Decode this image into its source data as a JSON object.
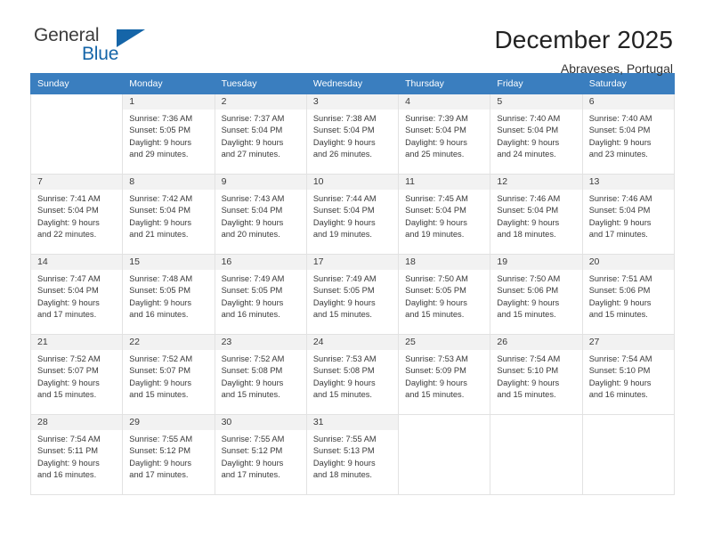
{
  "brand": {
    "word_one": "General",
    "word_two": "Blue",
    "accent_color": "#1565a8",
    "triangle_icon": "brand-triangle-icon"
  },
  "header": {
    "title": "December 2025",
    "subtitle": "Abraveses, Portugal"
  },
  "calendar": {
    "header_bg": "#3a7ebf",
    "daynum_band_bg": "#f2f2f2",
    "grid_line_color": "#e2e2e2",
    "weekday_headers": [
      "Sunday",
      "Monday",
      "Tuesday",
      "Wednesday",
      "Thursday",
      "Friday",
      "Saturday"
    ],
    "labels": {
      "sunrise_prefix": "Sunrise:",
      "sunset_prefix": "Sunset:",
      "daylight_prefix": "Daylight:"
    },
    "weeks": [
      [
        {
          "day": "",
          "lines": []
        },
        {
          "day": "1",
          "lines": [
            "Sunrise: 7:36 AM",
            "Sunset: 5:05 PM",
            "Daylight: 9 hours",
            "and 29 minutes."
          ]
        },
        {
          "day": "2",
          "lines": [
            "Sunrise: 7:37 AM",
            "Sunset: 5:04 PM",
            "Daylight: 9 hours",
            "and 27 minutes."
          ]
        },
        {
          "day": "3",
          "lines": [
            "Sunrise: 7:38 AM",
            "Sunset: 5:04 PM",
            "Daylight: 9 hours",
            "and 26 minutes."
          ]
        },
        {
          "day": "4",
          "lines": [
            "Sunrise: 7:39 AM",
            "Sunset: 5:04 PM",
            "Daylight: 9 hours",
            "and 25 minutes."
          ]
        },
        {
          "day": "5",
          "lines": [
            "Sunrise: 7:40 AM",
            "Sunset: 5:04 PM",
            "Daylight: 9 hours",
            "and 24 minutes."
          ]
        },
        {
          "day": "6",
          "lines": [
            "Sunrise: 7:40 AM",
            "Sunset: 5:04 PM",
            "Daylight: 9 hours",
            "and 23 minutes."
          ]
        }
      ],
      [
        {
          "day": "7",
          "lines": [
            "Sunrise: 7:41 AM",
            "Sunset: 5:04 PM",
            "Daylight: 9 hours",
            "and 22 minutes."
          ]
        },
        {
          "day": "8",
          "lines": [
            "Sunrise: 7:42 AM",
            "Sunset: 5:04 PM",
            "Daylight: 9 hours",
            "and 21 minutes."
          ]
        },
        {
          "day": "9",
          "lines": [
            "Sunrise: 7:43 AM",
            "Sunset: 5:04 PM",
            "Daylight: 9 hours",
            "and 20 minutes."
          ]
        },
        {
          "day": "10",
          "lines": [
            "Sunrise: 7:44 AM",
            "Sunset: 5:04 PM",
            "Daylight: 9 hours",
            "and 19 minutes."
          ]
        },
        {
          "day": "11",
          "lines": [
            "Sunrise: 7:45 AM",
            "Sunset: 5:04 PM",
            "Daylight: 9 hours",
            "and 19 minutes."
          ]
        },
        {
          "day": "12",
          "lines": [
            "Sunrise: 7:46 AM",
            "Sunset: 5:04 PM",
            "Daylight: 9 hours",
            "and 18 minutes."
          ]
        },
        {
          "day": "13",
          "lines": [
            "Sunrise: 7:46 AM",
            "Sunset: 5:04 PM",
            "Daylight: 9 hours",
            "and 17 minutes."
          ]
        }
      ],
      [
        {
          "day": "14",
          "lines": [
            "Sunrise: 7:47 AM",
            "Sunset: 5:04 PM",
            "Daylight: 9 hours",
            "and 17 minutes."
          ]
        },
        {
          "day": "15",
          "lines": [
            "Sunrise: 7:48 AM",
            "Sunset: 5:05 PM",
            "Daylight: 9 hours",
            "and 16 minutes."
          ]
        },
        {
          "day": "16",
          "lines": [
            "Sunrise: 7:49 AM",
            "Sunset: 5:05 PM",
            "Daylight: 9 hours",
            "and 16 minutes."
          ]
        },
        {
          "day": "17",
          "lines": [
            "Sunrise: 7:49 AM",
            "Sunset: 5:05 PM",
            "Daylight: 9 hours",
            "and 15 minutes."
          ]
        },
        {
          "day": "18",
          "lines": [
            "Sunrise: 7:50 AM",
            "Sunset: 5:05 PM",
            "Daylight: 9 hours",
            "and 15 minutes."
          ]
        },
        {
          "day": "19",
          "lines": [
            "Sunrise: 7:50 AM",
            "Sunset: 5:06 PM",
            "Daylight: 9 hours",
            "and 15 minutes."
          ]
        },
        {
          "day": "20",
          "lines": [
            "Sunrise: 7:51 AM",
            "Sunset: 5:06 PM",
            "Daylight: 9 hours",
            "and 15 minutes."
          ]
        }
      ],
      [
        {
          "day": "21",
          "lines": [
            "Sunrise: 7:52 AM",
            "Sunset: 5:07 PM",
            "Daylight: 9 hours",
            "and 15 minutes."
          ]
        },
        {
          "day": "22",
          "lines": [
            "Sunrise: 7:52 AM",
            "Sunset: 5:07 PM",
            "Daylight: 9 hours",
            "and 15 minutes."
          ]
        },
        {
          "day": "23",
          "lines": [
            "Sunrise: 7:52 AM",
            "Sunset: 5:08 PM",
            "Daylight: 9 hours",
            "and 15 minutes."
          ]
        },
        {
          "day": "24",
          "lines": [
            "Sunrise: 7:53 AM",
            "Sunset: 5:08 PM",
            "Daylight: 9 hours",
            "and 15 minutes."
          ]
        },
        {
          "day": "25",
          "lines": [
            "Sunrise: 7:53 AM",
            "Sunset: 5:09 PM",
            "Daylight: 9 hours",
            "and 15 minutes."
          ]
        },
        {
          "day": "26",
          "lines": [
            "Sunrise: 7:54 AM",
            "Sunset: 5:10 PM",
            "Daylight: 9 hours",
            "and 15 minutes."
          ]
        },
        {
          "day": "27",
          "lines": [
            "Sunrise: 7:54 AM",
            "Sunset: 5:10 PM",
            "Daylight: 9 hours",
            "and 16 minutes."
          ]
        }
      ],
      [
        {
          "day": "28",
          "lines": [
            "Sunrise: 7:54 AM",
            "Sunset: 5:11 PM",
            "Daylight: 9 hours",
            "and 16 minutes."
          ]
        },
        {
          "day": "29",
          "lines": [
            "Sunrise: 7:55 AM",
            "Sunset: 5:12 PM",
            "Daylight: 9 hours",
            "and 17 minutes."
          ]
        },
        {
          "day": "30",
          "lines": [
            "Sunrise: 7:55 AM",
            "Sunset: 5:12 PM",
            "Daylight: 9 hours",
            "and 17 minutes."
          ]
        },
        {
          "day": "31",
          "lines": [
            "Sunrise: 7:55 AM",
            "Sunset: 5:13 PM",
            "Daylight: 9 hours",
            "and 18 minutes."
          ]
        },
        {
          "day": "",
          "lines": []
        },
        {
          "day": "",
          "lines": []
        },
        {
          "day": "",
          "lines": []
        }
      ]
    ]
  }
}
